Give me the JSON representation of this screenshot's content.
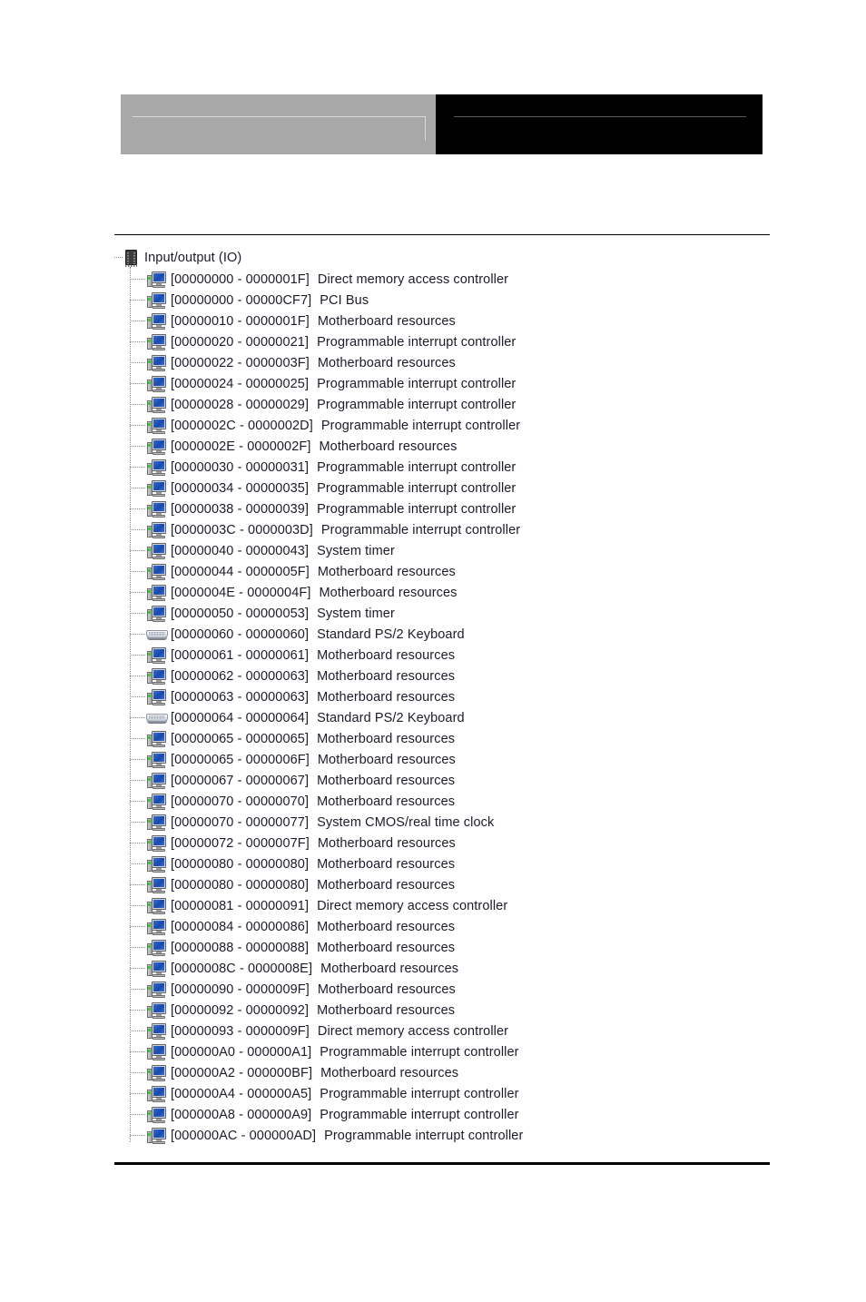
{
  "banner": {
    "left_text": "",
    "right_text": ""
  },
  "tree": {
    "root": {
      "label": "Input/output (IO)",
      "icon": "chip-icon"
    },
    "rows": [
      {
        "range": "[00000000 - 0000001F]",
        "desc": "Direct memory access controller",
        "icon": "computer-icon"
      },
      {
        "range": "[00000000 - 00000CF7]",
        "desc": "PCI Bus",
        "icon": "computer-icon"
      },
      {
        "range": "[00000010 - 0000001F]",
        "desc": "Motherboard resources",
        "icon": "computer-icon"
      },
      {
        "range": "[00000020 - 00000021]",
        "desc": "Programmable interrupt controller",
        "icon": "computer-icon"
      },
      {
        "range": "[00000022 - 0000003F]",
        "desc": "Motherboard resources",
        "icon": "computer-icon"
      },
      {
        "range": "[00000024 - 00000025]",
        "desc": "Programmable interrupt controller",
        "icon": "computer-icon"
      },
      {
        "range": "[00000028 - 00000029]",
        "desc": "Programmable interrupt controller",
        "icon": "computer-icon"
      },
      {
        "range": "[0000002C - 0000002D]",
        "desc": "Programmable interrupt controller",
        "icon": "computer-icon"
      },
      {
        "range": "[0000002E - 0000002F]",
        "desc": "Motherboard resources",
        "icon": "computer-icon"
      },
      {
        "range": "[00000030 - 00000031]",
        "desc": "Programmable interrupt controller",
        "icon": "computer-icon"
      },
      {
        "range": "[00000034 - 00000035]",
        "desc": "Programmable interrupt controller",
        "icon": "computer-icon"
      },
      {
        "range": "[00000038 - 00000039]",
        "desc": "Programmable interrupt controller",
        "icon": "computer-icon"
      },
      {
        "range": "[0000003C - 0000003D]",
        "desc": "Programmable interrupt controller",
        "icon": "computer-icon"
      },
      {
        "range": "[00000040 - 00000043]",
        "desc": "System timer",
        "icon": "computer-icon"
      },
      {
        "range": "[00000044 - 0000005F]",
        "desc": "Motherboard resources",
        "icon": "computer-icon"
      },
      {
        "range": "[0000004E - 0000004F]",
        "desc": "Motherboard resources",
        "icon": "computer-icon"
      },
      {
        "range": "[00000050 - 00000053]",
        "desc": "System timer",
        "icon": "computer-icon"
      },
      {
        "range": "[00000060 - 00000060]",
        "desc": "Standard PS/2 Keyboard",
        "icon": "keyboard-icon"
      },
      {
        "range": "[00000061 - 00000061]",
        "desc": "Motherboard resources",
        "icon": "computer-icon"
      },
      {
        "range": "[00000062 - 00000063]",
        "desc": "Motherboard resources",
        "icon": "computer-icon"
      },
      {
        "range": "[00000063 - 00000063]",
        "desc": "Motherboard resources",
        "icon": "computer-icon"
      },
      {
        "range": "[00000064 - 00000064]",
        "desc": "Standard PS/2 Keyboard",
        "icon": "keyboard-icon"
      },
      {
        "range": "[00000065 - 00000065]",
        "desc": "Motherboard resources",
        "icon": "computer-icon"
      },
      {
        "range": "[00000065 - 0000006F]",
        "desc": "Motherboard resources",
        "icon": "computer-icon"
      },
      {
        "range": "[00000067 - 00000067]",
        "desc": "Motherboard resources",
        "icon": "computer-icon"
      },
      {
        "range": "[00000070 - 00000070]",
        "desc": "Motherboard resources",
        "icon": "computer-icon"
      },
      {
        "range": "[00000070 - 00000077]",
        "desc": "System CMOS/real time clock",
        "icon": "computer-icon"
      },
      {
        "range": "[00000072 - 0000007F]",
        "desc": "Motherboard resources",
        "icon": "computer-icon"
      },
      {
        "range": "[00000080 - 00000080]",
        "desc": "Motherboard resources",
        "icon": "computer-icon"
      },
      {
        "range": "[00000080 - 00000080]",
        "desc": "Motherboard resources",
        "icon": "computer-icon"
      },
      {
        "range": "[00000081 - 00000091]",
        "desc": "Direct memory access controller",
        "icon": "computer-icon"
      },
      {
        "range": "[00000084 - 00000086]",
        "desc": "Motherboard resources",
        "icon": "computer-icon"
      },
      {
        "range": "[00000088 - 00000088]",
        "desc": "Motherboard resources",
        "icon": "computer-icon"
      },
      {
        "range": "[0000008C - 0000008E]",
        "desc": "Motherboard resources",
        "icon": "computer-icon"
      },
      {
        "range": "[00000090 - 0000009F]",
        "desc": "Motherboard resources",
        "icon": "computer-icon"
      },
      {
        "range": "[00000092 - 00000092]",
        "desc": "Motherboard resources",
        "icon": "computer-icon"
      },
      {
        "range": "[00000093 - 0000009F]",
        "desc": "Direct memory access controller",
        "icon": "computer-icon"
      },
      {
        "range": "[000000A0 - 000000A1]",
        "desc": "Programmable interrupt controller",
        "icon": "computer-icon"
      },
      {
        "range": "[000000A2 - 000000BF]",
        "desc": "Motherboard resources",
        "icon": "computer-icon"
      },
      {
        "range": "[000000A4 - 000000A5]",
        "desc": "Programmable interrupt controller",
        "icon": "computer-icon"
      },
      {
        "range": "[000000A8 - 000000A9]",
        "desc": "Programmable interrupt controller",
        "icon": "computer-icon"
      },
      {
        "range": "[000000AC - 000000AD]",
        "desc": "Programmable interrupt controller",
        "icon": "computer-icon"
      }
    ]
  },
  "colors": {
    "banner_gray": "#a8a8a8",
    "banner_black": "#000000",
    "text": "#1c1c28",
    "rule": "#000000"
  }
}
